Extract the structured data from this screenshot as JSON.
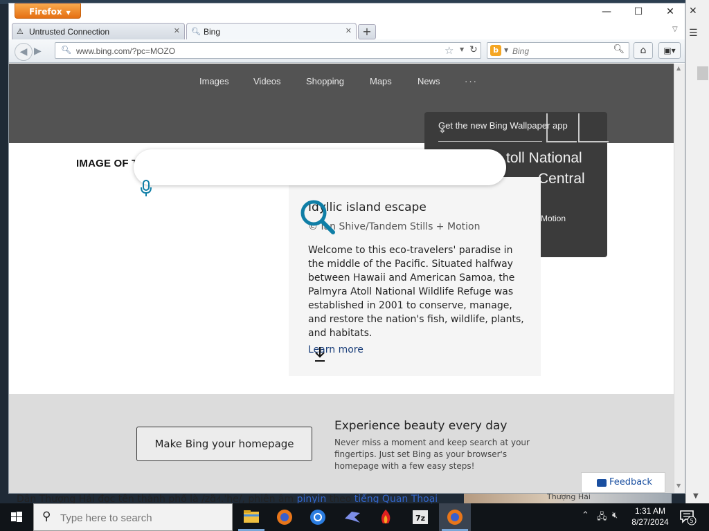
{
  "browser": {
    "app_button": "Firefox",
    "tabs": [
      {
        "label": "Untrusted Connection",
        "icon": "warning-icon"
      },
      {
        "label": "Bing",
        "icon": "search-icon"
      }
    ],
    "url": "www.bing.com/?pc=MOZO",
    "search_placeholder": "Bing"
  },
  "bing": {
    "nav": [
      "Images",
      "Videos",
      "Shopping",
      "Maps",
      "News",
      "···"
    ],
    "image_of_the_day": "IMAGE OF THE DAY",
    "wallpaper_heading": "Get the new Bing Wallpaper app",
    "wallpaper_title_line1": "toll National",
    "wallpaper_title_line2": "Central",
    "wallpaper_credit": "Motion",
    "story": {
      "title": "Idyllic island escape",
      "copyright": "© Ian Shive/Tandem Stills + Motion",
      "body": "Welcome to this eco-travelers' paradise in the middle of the Pacific. Situated halfway between Hawaii and American Samoa, the Palmyra Atoll National Wildlife Refuge was established in 2001 to conserve, manage, and restore the nation's fish, wildlife, plants, and habitats.",
      "link": "Learn more"
    },
    "homepage_button": "Make Bing your homepage",
    "experience_title": "Experience beauty every day",
    "experience_body": "Never miss a moment and keep search at your fingertips. Just set Bing as your browser's homepage with a few easy steps!",
    "feedback": "Feedback"
  },
  "background": {
    "doc_text_a": "Dân Thượng Hải đọc tên thành phố là /zɑ̃˨˦.'he/, phiên âm ",
    "doc_link_a": "pinyin",
    "doc_text_b": " theo ",
    "doc_link_b": "tiếng Quan Thoại",
    "img_caption": "Thượng Hải"
  },
  "taskbar": {
    "search_placeholder": "Type here to search",
    "apps": [
      "file-explorer-icon",
      "firefox-icon",
      "chrome-icon",
      "bird-app-icon",
      "flame-app-icon",
      "7zip-icon",
      "firefox-active-icon"
    ],
    "time": "1:31 AM",
    "date": "8/27/2024",
    "notification_count": "5"
  },
  "colors": {
    "hero": "#535353",
    "accent_blue": "#0f7ea6",
    "link": "#1a3e7a",
    "firefox_orange": "#e8761a"
  }
}
